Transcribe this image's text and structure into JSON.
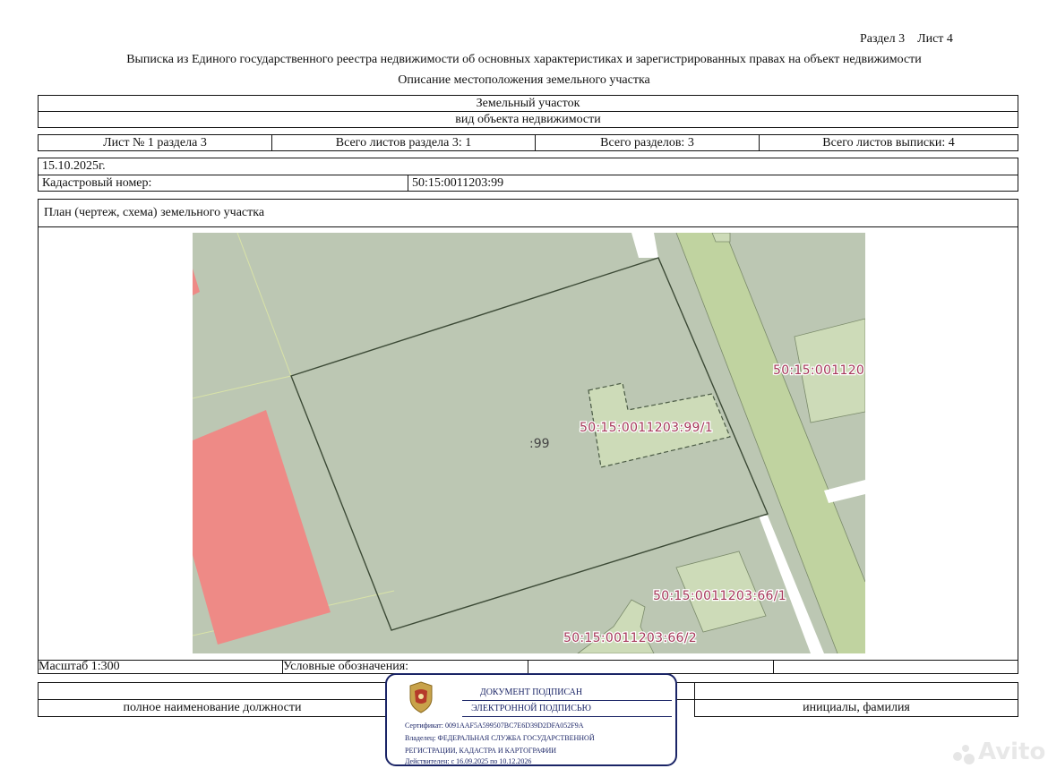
{
  "header": {
    "section": "Раздел 3",
    "sheet": "Лист 4",
    "title": "Выписка из Единого государственного реестра недвижимости об основных характеристиках и зарегистрированных правах на объект недвижимости",
    "subtitle": "Описание местоположения земельного участка"
  },
  "object": {
    "type": "Земельный участок",
    "type_caption": "вид объекта недвижимости"
  },
  "sheets": {
    "sheet_no": "Лист № 1 раздела 3",
    "total_sheets_section": "Всего листов раздела 3: 1",
    "total_sections": "Всего разделов: 3",
    "total_sheets_extract": "Всего листов выписки: 4"
  },
  "record": {
    "date": "15.10.2025г.",
    "cadastral_label": "Кадастровый номер:",
    "cadastral_number": "50:15:0011203:99"
  },
  "plan": {
    "title": "План (чертеж, схема) земельного участка",
    "labels": {
      "main_parcel": ":99",
      "building_1": "50:15:0011203:99/1",
      "neighbor_right": "50:15:001120",
      "building_66_1": "50:15:0011203:66/1",
      "building_66_2": "50:15:0011203:66/2"
    },
    "colors": {
      "background": "#bcc7b3",
      "red_zone": "#ee8a86",
      "light_parcel": "#cddbb8",
      "road": "#c0d3a0",
      "label": "#a6385a"
    }
  },
  "footer": {
    "scale": "Масштаб 1:300",
    "legend": "Условные обозначения:",
    "position_caption": "полное наименование должности",
    "name_caption": "инициалы, фамилия"
  },
  "stamp": {
    "line1": "ДОКУМЕНТ ПОДПИСАН",
    "line2": "ЭЛЕКТРОННОЙ ПОДПИСЬЮ",
    "certificate": "Сертификат: 0091AAF5A599507BC7E6D39D2DFA052F9A",
    "owner_1": "Владелец: ФЕДЕРАЛЬНАЯ СЛУЖБА ГОСУДАРСТВЕННОЙ",
    "owner_2": "РЕГИСТРАЦИИ, КАДАСТРА И КАРТОГРАФИИ",
    "valid": "Действителен: с 16.09.2025 по 10.12.2026",
    "emblem_icon": "coat-of-arms-icon"
  },
  "watermark": {
    "text": "Avito"
  }
}
